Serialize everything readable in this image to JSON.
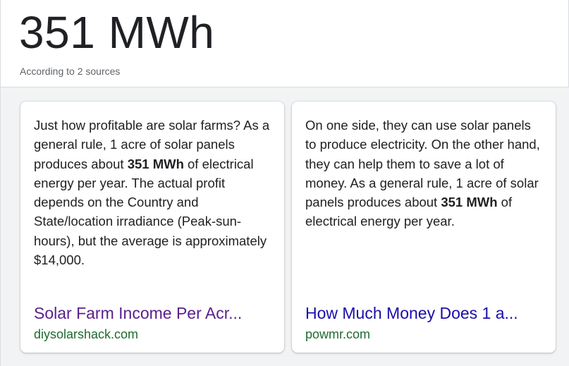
{
  "answer": {
    "value": "351 MWh",
    "sources_label": "According to 2 sources"
  },
  "cards": [
    {
      "snippet_before": "Just how profitable are solar farms? As a general rule, 1 acre of solar panels produces about ",
      "snippet_bold": "351 MWh",
      "snippet_after": " of electrical energy per year. The actual profit depends on the Country and State/location irradiance (Peak-sun-hours), but the average is approximately $14,000.",
      "title": "Solar Farm Income Per Acr...",
      "domain": "diysolarshack.com",
      "title_color": "#5a1e8c"
    },
    {
      "snippet_before": "On one side, they can use solar panels to produce electricity. On the other hand, they can help them to save a lot of money. As a general rule, 1 acre of solar panels produces about ",
      "snippet_bold": "351 MWh",
      "snippet_after": " of electrical energy per year.",
      "title": "How Much Money Does 1 a...",
      "domain": "powmr.com",
      "title_color": "#1a0dab"
    }
  ],
  "colors": {
    "background_panel": "#f1f3f4",
    "url_green": "#1e6b2e",
    "text": "#202124",
    "secondary_text": "#5f6368"
  }
}
